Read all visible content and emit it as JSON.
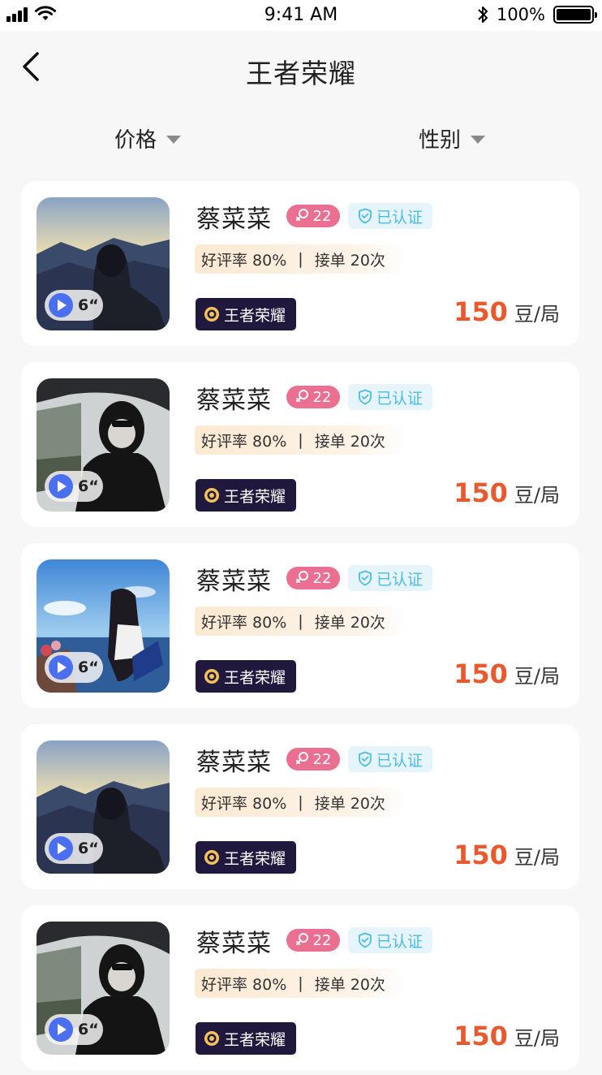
{
  "status_bar": {
    "time": "9:41 AM",
    "battery": "100%"
  },
  "nav": {
    "title": "王者荣耀"
  },
  "filters": [
    {
      "label": "价格"
    },
    {
      "label": "性别"
    }
  ],
  "cards": [
    {
      "name": "蔡菜菜",
      "age": "22",
      "verified": "已认证",
      "rating": "好评率 80%",
      "orders": "接单 20次",
      "game": "王者荣耀",
      "video_duration": "6“",
      "price": "150",
      "unit": "豆/局",
      "photo": "mountain"
    },
    {
      "name": "蔡菜菜",
      "age": "22",
      "verified": "已认证",
      "rating": "好评率 80%",
      "orders": "接单 20次",
      "game": "王者荣耀",
      "video_duration": "6“",
      "price": "150",
      "unit": "豆/局",
      "photo": "car"
    },
    {
      "name": "蔡菜菜",
      "age": "22",
      "verified": "已认证",
      "rating": "好评率 80%",
      "orders": "接单 20次",
      "game": "王者荣耀",
      "video_duration": "6“",
      "price": "150",
      "unit": "豆/局",
      "photo": "sea"
    },
    {
      "name": "蔡菜菜",
      "age": "22",
      "verified": "已认证",
      "rating": "好评率 80%",
      "orders": "接单 20次",
      "game": "王者荣耀",
      "video_duration": "6“",
      "price": "150",
      "unit": "豆/局",
      "photo": "mountain"
    },
    {
      "name": "蔡菜菜",
      "age": "22",
      "verified": "已认证",
      "rating": "好评率 80%",
      "orders": "接单 20次",
      "game": "王者荣耀",
      "video_duration": "6“",
      "price": "150",
      "unit": "豆/局",
      "photo": "car"
    }
  ],
  "colors": {
    "price": "#e8592d",
    "age_badge": "#ea6f90",
    "verify_text": "#4bbbe6",
    "game_tag_bg": "#21183d",
    "play_button": "#4a6ff0"
  }
}
